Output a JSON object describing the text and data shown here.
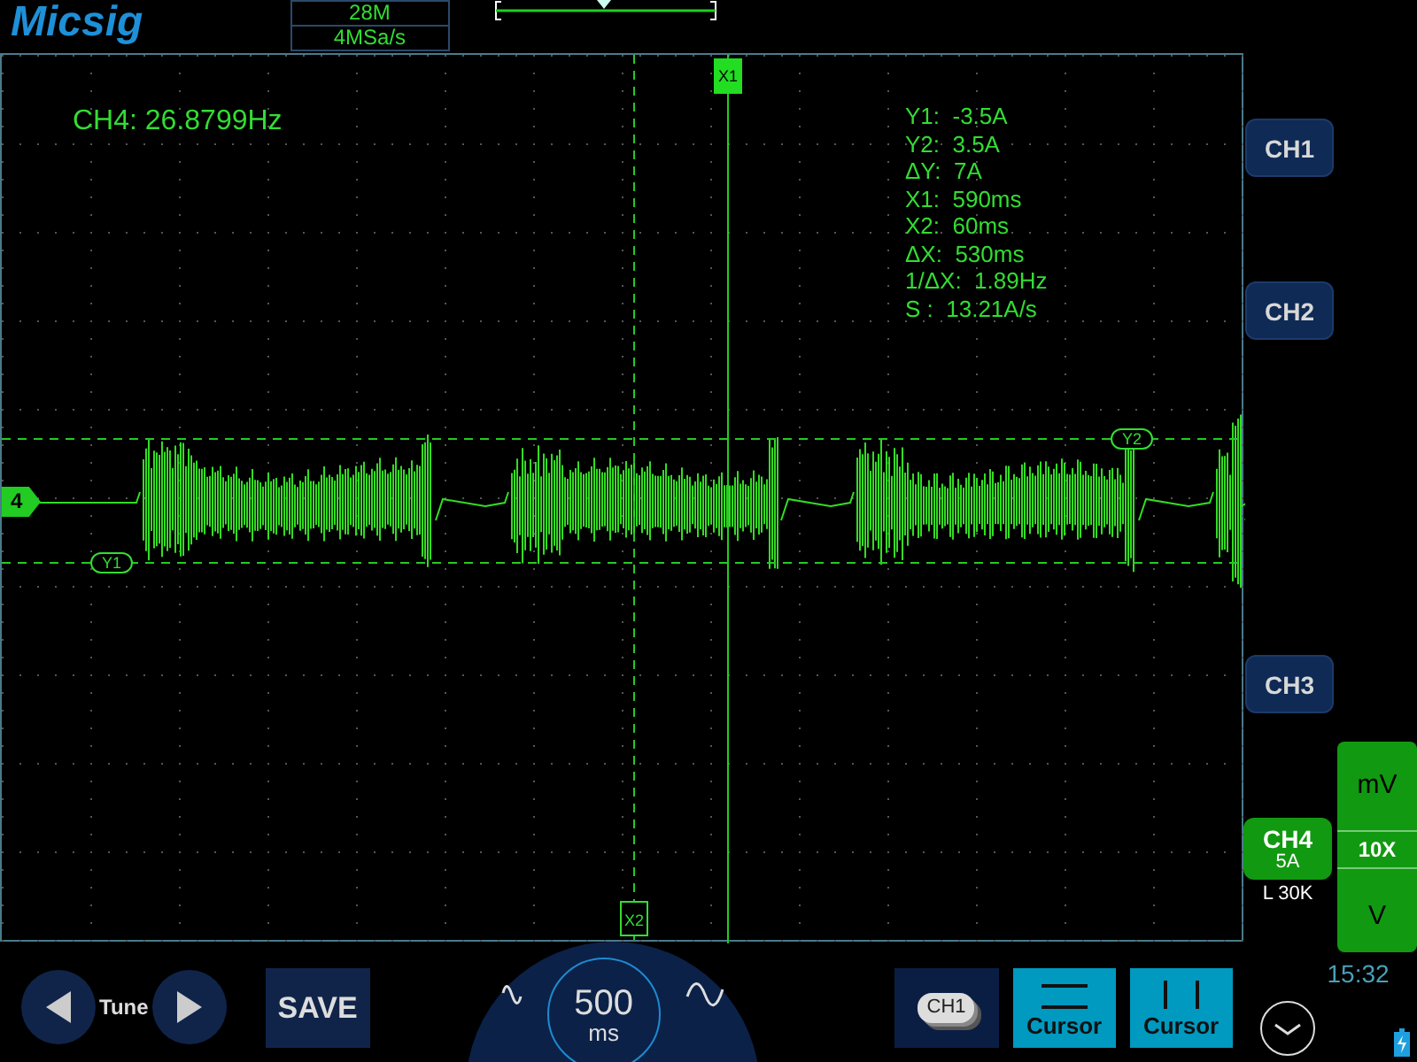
{
  "header": {
    "logo": "Micsig",
    "memory_depth": "28M",
    "sample_rate": "4MSa/s"
  },
  "screen": {
    "frequency_readout": "CH4: 26.8799Hz",
    "channel_marker": "4",
    "measurements": [
      "Y1:  -3.5A",
      "Y2:  3.5A",
      "ΔY:  7A",
      "X1:  590ms",
      "X2:  60ms",
      "ΔX:  530ms",
      "1/ΔX:  1.89Hz",
      "S :  13.21A/s"
    ],
    "cursors": [
      {
        "label": "X1",
        "kind": "vertical"
      },
      {
        "label": "X2",
        "kind": "vertical"
      },
      {
        "label": "Y1",
        "kind": "horizontal"
      },
      {
        "label": "Y2",
        "kind": "horizontal"
      }
    ]
  },
  "right_panel": {
    "channels": [
      {
        "label": "CH1",
        "selected": false
      },
      {
        "label": "CH2",
        "selected": false
      },
      {
        "label": "CH3",
        "selected": false
      },
      {
        "label": "CH4",
        "selected": true,
        "scale": "5A",
        "coupling": "L 30K"
      }
    ],
    "units": [
      "mV",
      "10X",
      "V"
    ],
    "time": "15:32"
  },
  "bottom_bar": {
    "tune": "Tune",
    "save": "SAVE",
    "timebase": {
      "value": "500",
      "unit": "ms"
    },
    "channel_button": "CH1",
    "cursor_buttons": [
      {
        "label": "Cursor",
        "kind": "horizontal"
      },
      {
        "label": "Cursor",
        "kind": "vertical"
      }
    ]
  }
}
